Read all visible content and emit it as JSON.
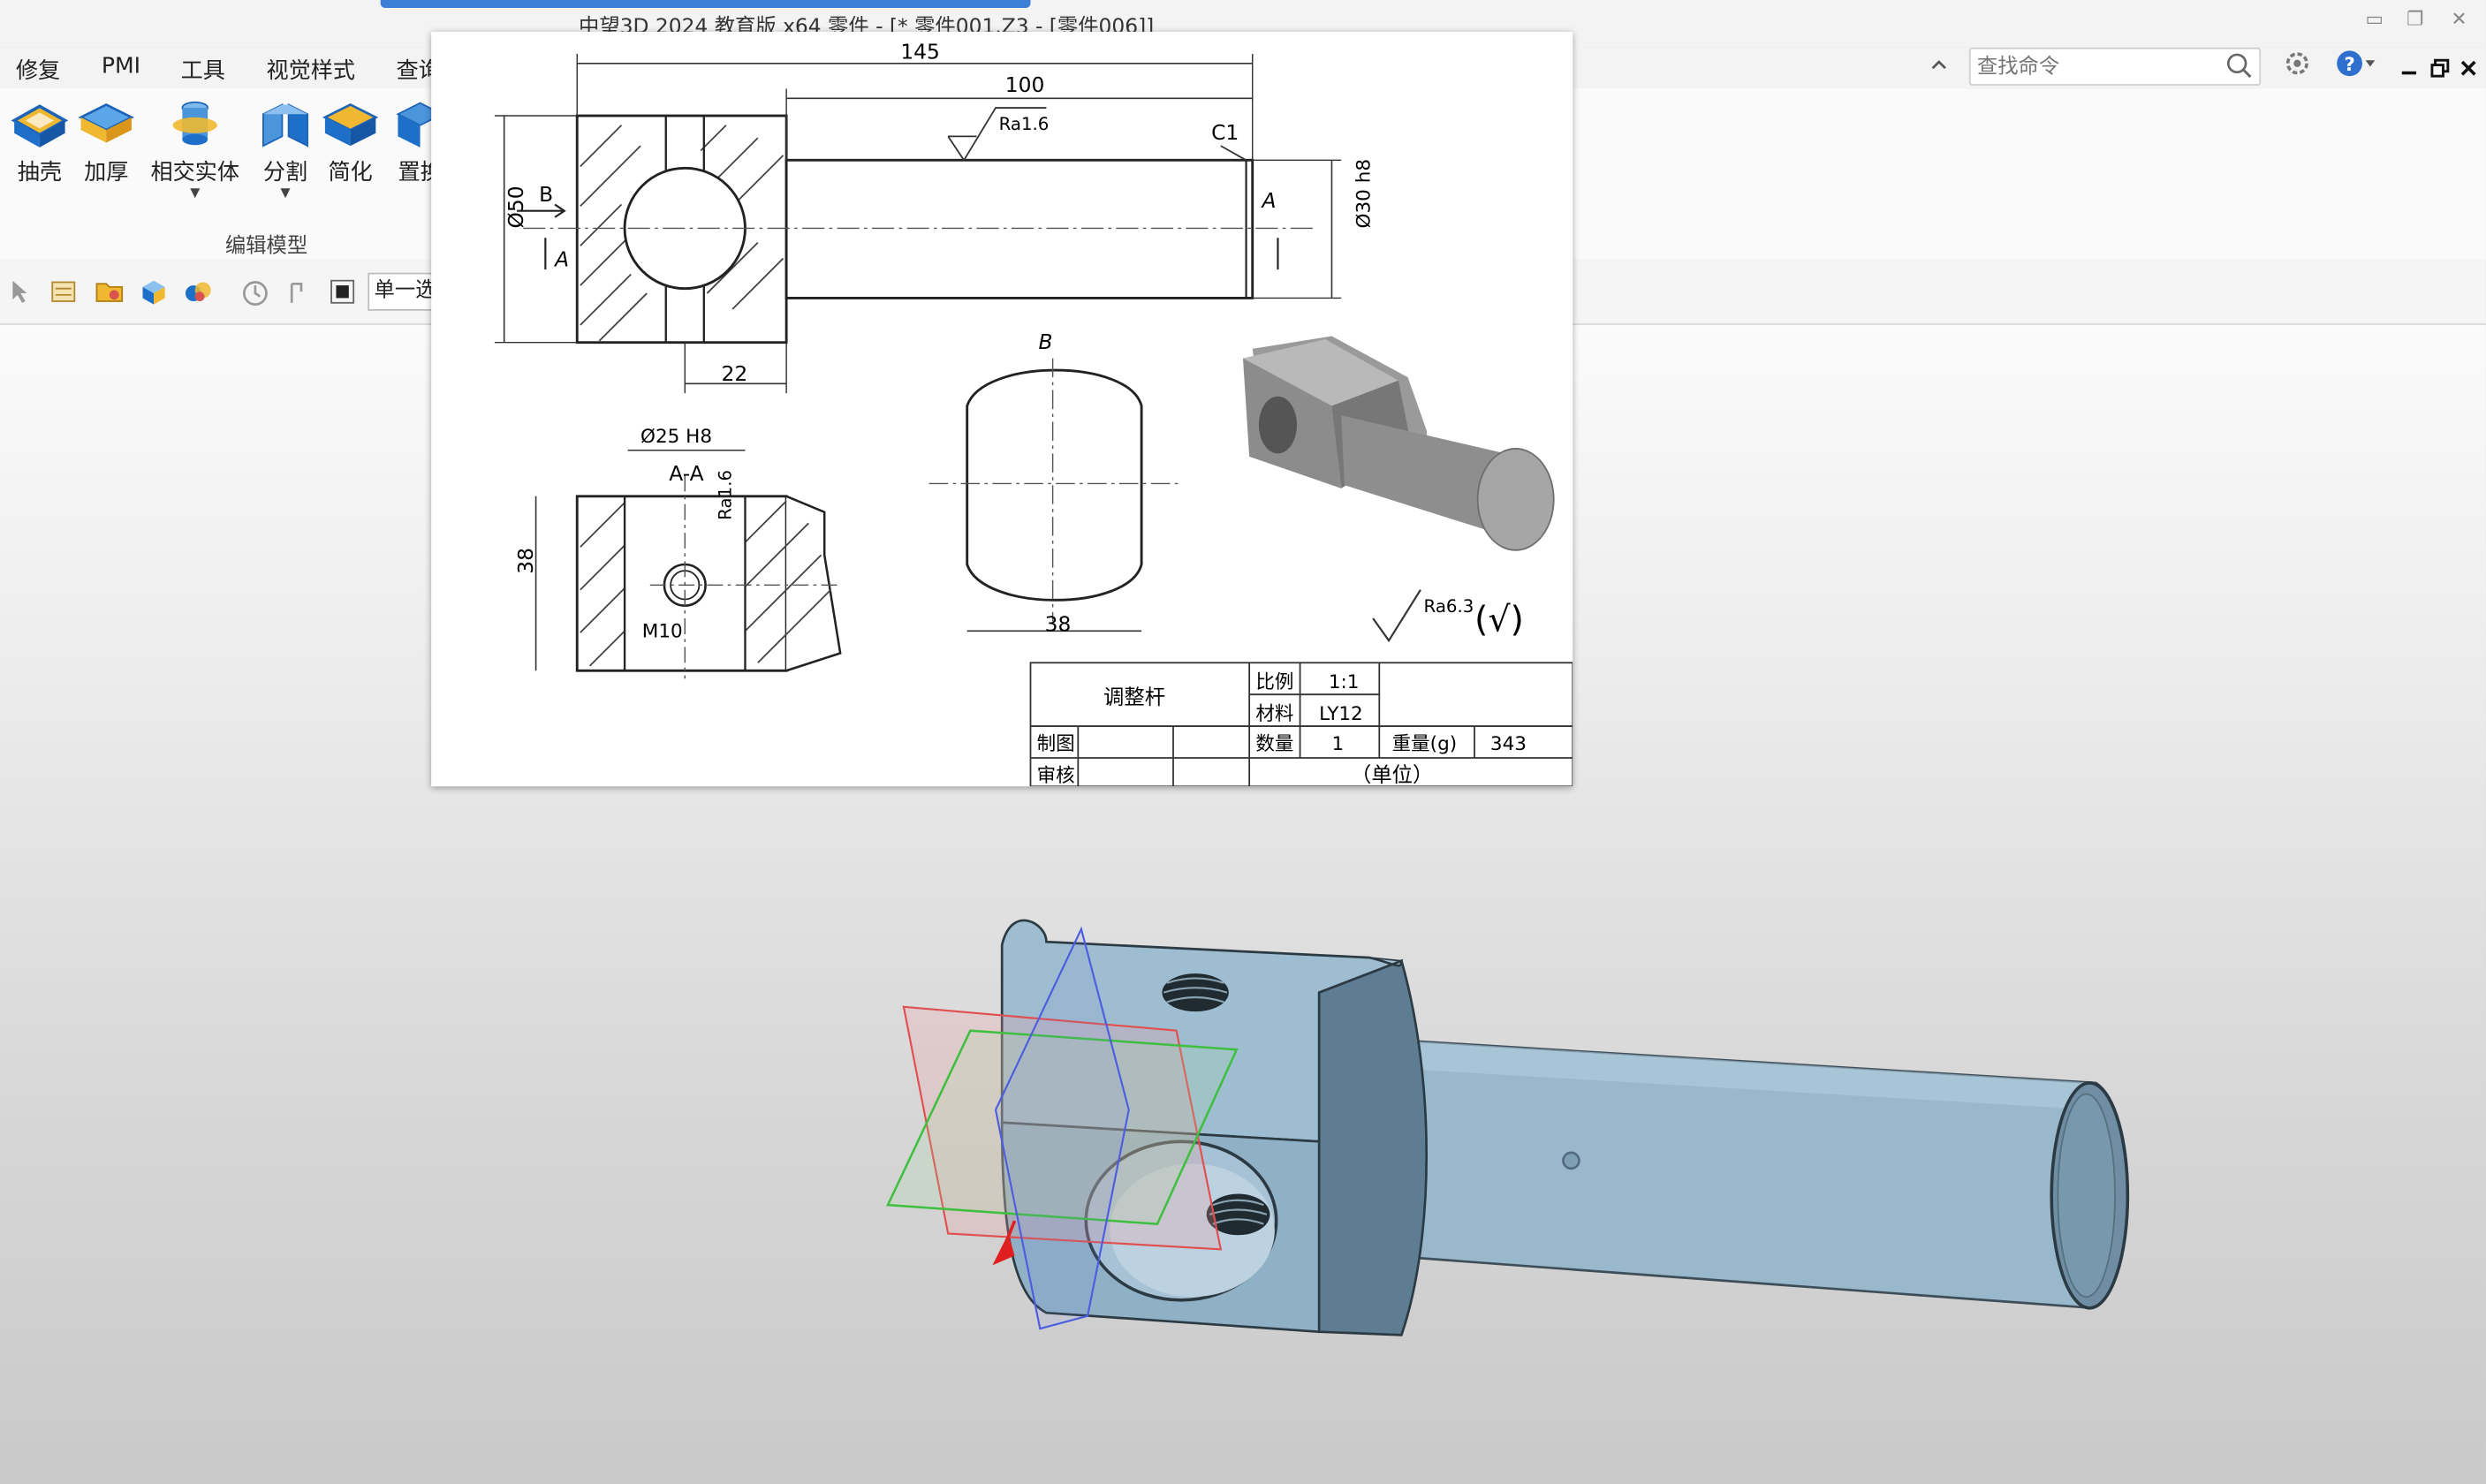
{
  "window": {
    "title": "中望3D 2024 教育版 x64        零件 - [* 零件001.Z3 - [零件006]]"
  },
  "menu": {
    "items": [
      "修复",
      "PMI",
      "工具",
      "视觉样式",
      "查询"
    ]
  },
  "search": {
    "placeholder": "查找命令"
  },
  "ribbon": {
    "buttons": [
      {
        "label": "抽壳",
        "icon": "shell-icon"
      },
      {
        "label": "加厚",
        "icon": "thicken-icon"
      },
      {
        "label": "相交实体",
        "icon": "intersect-solid-icon"
      },
      {
        "label": "分割",
        "icon": "split-icon"
      },
      {
        "label": "简化",
        "icon": "simplify-icon"
      },
      {
        "label": "置换",
        "icon": "replace-icon"
      }
    ],
    "group_label": "编辑模型"
  },
  "toolbar2": {
    "filter_value": "单一选择"
  },
  "drawing": {
    "dims": {
      "d145": "145",
      "d100": "100",
      "ra16": "Ra1.6",
      "c1": "C1",
      "phi50": "Ø50",
      "phi30": "Ø30 h8",
      "sec_b": "B",
      "sec_a": "A",
      "d22": "22",
      "phi25": "Ø25 H8",
      "view_aa": "A-A",
      "d38v": "38",
      "ra16v": "Ra1.6",
      "m10": "M10",
      "view_b": "B",
      "d38h": "38",
      "ra63": "Ra6.3",
      "check": "(√)"
    },
    "titleblock": {
      "part_name": "调整杆",
      "scale_label": "比例",
      "scale_value": "1:1",
      "material_label": "材料",
      "material_value": "LY12",
      "drawn_label": "制图",
      "review_label": "审核",
      "qty_label": "数量",
      "qty_value": "1",
      "weight_label": "重量(g)",
      "weight_value": "343",
      "unit": "（单位）"
    }
  },
  "colors": {
    "model_fill": "#9fbdd0",
    "model_dark": "#7795a9",
    "accent": "#3d7fd6"
  }
}
